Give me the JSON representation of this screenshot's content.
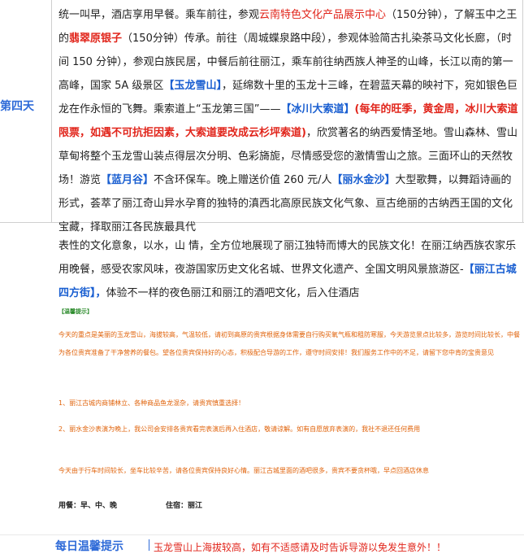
{
  "day_label": "第四天",
  "main": {
    "s1": "统一叫早，酒店享用早餐。乘车前往，参观",
    "s2": "云南特色文化产品展示中心",
    "s3": "（150分钟），了解玉中之王的",
    "s4": "翡翠原银子",
    "s5": "（150分钟）传承。前往（周城蝶泉路中段），参观体验简古扎染茶马文化长廊，（时间 150 分钟），参观白族民居，中餐后前往丽江，乘车前往纳西族人神圣的山峰，长江以南的第一高峰，国家 5A 级景区",
    "s6": "【玉龙雪山】",
    "s7": "，延绵数十里的玉龙十三峰，在碧蓝天幕的映衬下，宛如银色巨龙在作永恒的飞舞。乘索道上“玉龙第三国”——",
    "s8": "【冰川大索道】",
    "s9": "(每年的旺季，黄金周，冰川大索道限票，如遇不可抗拒因素，大索道要改成云杉坪索道)",
    "s10": "，欣赏著名的纳西爱情圣地。雪山森林、雪山草甸将整个玉龙雪山装点得层次分明、色彩旖旎，尽情感受您的激情雪山之旅。三面环山的天然牧场！游览",
    "s11": "【蓝月谷】",
    "s12": "不含环保车。晚上赠送价值 260 元/人",
    "s13": "【丽水金沙】",
    "s14": "大型歌舞，以舞蹈诗画的形式，荟萃了丽江奇山异水孕育的独特的滇西北高原民族文化气象、亘古绝丽的古纳西王国的文化宝藏，择取丽江各民族最具代"
  },
  "cont": {
    "c1": "表性的文化意象，以水，山 情，全方位地展现了丽江独特而博大的民族文化！在丽江纳西族农家乐用晚餐，感受农家风味，夜游国家历史文化名城、世界文化遗产、全国文明风景旅游区-",
    "c2": "【丽江古城四方街】，",
    "c3": "体验不一样的夜色丽江和丽江的酒吧文化，后入住酒店"
  },
  "tip_tag": "【温馨提示】",
  "notes": [
    "今天的重点是美丽的玉龙雪山，海拔较高，气温较低，请初到高原的贵宾根据身体需要自行购买氧气瓶和租防寒服，今天游览景点比较多，游览时间比较长，中餐为各位贵宾准备了干净营养的餐包。望各位贵宾保持好的心态，积极配合导游的工作，遵守时间安排！我们服务工作中的不足，请留下您中肯的宝贵意见",
    "1、丽江古城内商铺林立、各种商品鱼龙混杂，请贵宾慎重选择！",
    "2、丽水金沙表演为晚上，我公司会安排各贵宾看完表演后再入住酒店，敬请谅解。如有自愿放弃表演的，我社不退还任何费用",
    "今天由于行车时间较长，坐车比较辛苦，请各位贵宾保持良好心情。丽江古城里面的酒吧很多，贵宾不要贪杯哦，早点回酒店休息"
  ],
  "meals": "用餐：早、中、晚",
  "stay": "住宿：丽江",
  "bottom": {
    "title": "每日温馨提示",
    "text": "玉龙雪山上海拔较高，如有不适感请及时告诉导游以免发生意外！！"
  }
}
